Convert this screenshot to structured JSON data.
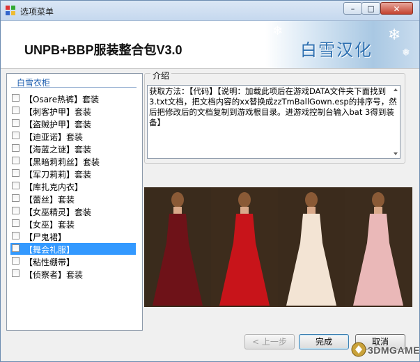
{
  "window": {
    "title": "选项菜单",
    "controls": {
      "min": "–",
      "max": "□",
      "close": "✕"
    }
  },
  "banner": {
    "title": "UNPB+BBP服装整合包V3.0",
    "logo_text": "白雪汉化"
  },
  "list": {
    "header": "白雪衣柜",
    "items": [
      {
        "label": "【Osare热裤】套装",
        "checked": false,
        "selected": false
      },
      {
        "label": "【刺客护甲】套装",
        "checked": false,
        "selected": false
      },
      {
        "label": "【盗贼护甲】套装",
        "checked": false,
        "selected": false
      },
      {
        "label": "【迪亚诺】套装",
        "checked": false,
        "selected": false
      },
      {
        "label": "【海蓝之谜】套装",
        "checked": false,
        "selected": false
      },
      {
        "label": "【黑暗莉莉丝】套装",
        "checked": false,
        "selected": false
      },
      {
        "label": "【军刀莉莉】套装",
        "checked": false,
        "selected": false
      },
      {
        "label": "【库扎克内衣】",
        "checked": false,
        "selected": false
      },
      {
        "label": "【蕾丝】套装",
        "checked": false,
        "selected": false
      },
      {
        "label": "【女巫精灵】套装",
        "checked": false,
        "selected": false
      },
      {
        "label": "【女巫】套装",
        "checked": false,
        "selected": false
      },
      {
        "label": "【尸鬼裙】",
        "checked": false,
        "selected": false
      },
      {
        "label": "【舞会礼服】",
        "checked": false,
        "selected": true
      },
      {
        "label": "【粘性绷带】",
        "checked": false,
        "selected": false
      },
      {
        "label": "【侦察者】套装",
        "checked": false,
        "selected": false
      }
    ]
  },
  "intro": {
    "legend": "介绍",
    "text": "获取方法：【代码】【说明：加载此项后在游戏DATA文件夹下面找到3.txt文档，把文档内容的xx替换成zzTmBallGown.esp的排序号，然后把修改后的文档复制到游戏根目录。进游戏控制台输入bat  3得到装备】"
  },
  "preview": {
    "dress_colors": [
      "#6e1218",
      "#c8141a",
      "#f3e4d4",
      "#eab8b8"
    ],
    "background": "#2a2118"
  },
  "buttons": {
    "back": "< 上一步",
    "finish": "完成",
    "cancel": "取消"
  },
  "watermark": {
    "text": "3DMGAME"
  }
}
